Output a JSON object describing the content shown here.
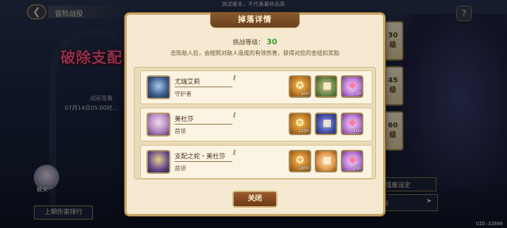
{
  "top_notice": "测试版本，不代表最终品质",
  "header": {
    "title": "冒险战役"
  },
  "background": {
    "big_title": "破除支配",
    "prep_label": "战前准备",
    "date_text": "07月14日05:00时…",
    "avatar_name": "颖天",
    "rank_button": "上期伤害排行",
    "strength_setting": "强度设定",
    "level_select": "级",
    "uid": "UID:32600"
  },
  "level_tabs": [
    {
      "num": "30",
      "unit": "级"
    },
    {
      "num": "45",
      "unit": "级"
    },
    {
      "num": "60",
      "unit": "级"
    }
  ],
  "modal": {
    "title": "掉落详情",
    "challenge_label": "挑战等级：",
    "challenge_level": "30",
    "description": "击败敌人后，会按照对敌人造成的有效伤害，获得对应的金纽扣奖励",
    "close_label": "关闭",
    "enemies": [
      {
        "name": "尤瑞艾莉",
        "role": "守护者",
        "portrait_color": "#3b5a8c",
        "rewards": [
          {
            "icon": "gold-button-icon",
            "qty": "600"
          },
          {
            "icon": "chest-icon",
            "qty": ""
          },
          {
            "icon": "gem-icon",
            "qty": "50"
          }
        ]
      },
      {
        "name": "美杜莎",
        "role": "首领",
        "portrait_color": "#b48ac2",
        "rewards": [
          {
            "icon": "gold-button-icon",
            "qty": "1200"
          },
          {
            "icon": "chest-icon",
            "qty": ""
          },
          {
            "icon": "gem-icon",
            "qty": "100"
          }
        ]
      },
      {
        "name": "支配之蛇・美杜莎",
        "role": "首领",
        "portrait_color": "#6a4a8a",
        "rewards": [
          {
            "icon": "gold-button-icon",
            "qty": "1800"
          },
          {
            "icon": "chest-icon",
            "qty": ""
          },
          {
            "icon": "gem-icon",
            "qty": "200"
          }
        ]
      }
    ]
  }
}
